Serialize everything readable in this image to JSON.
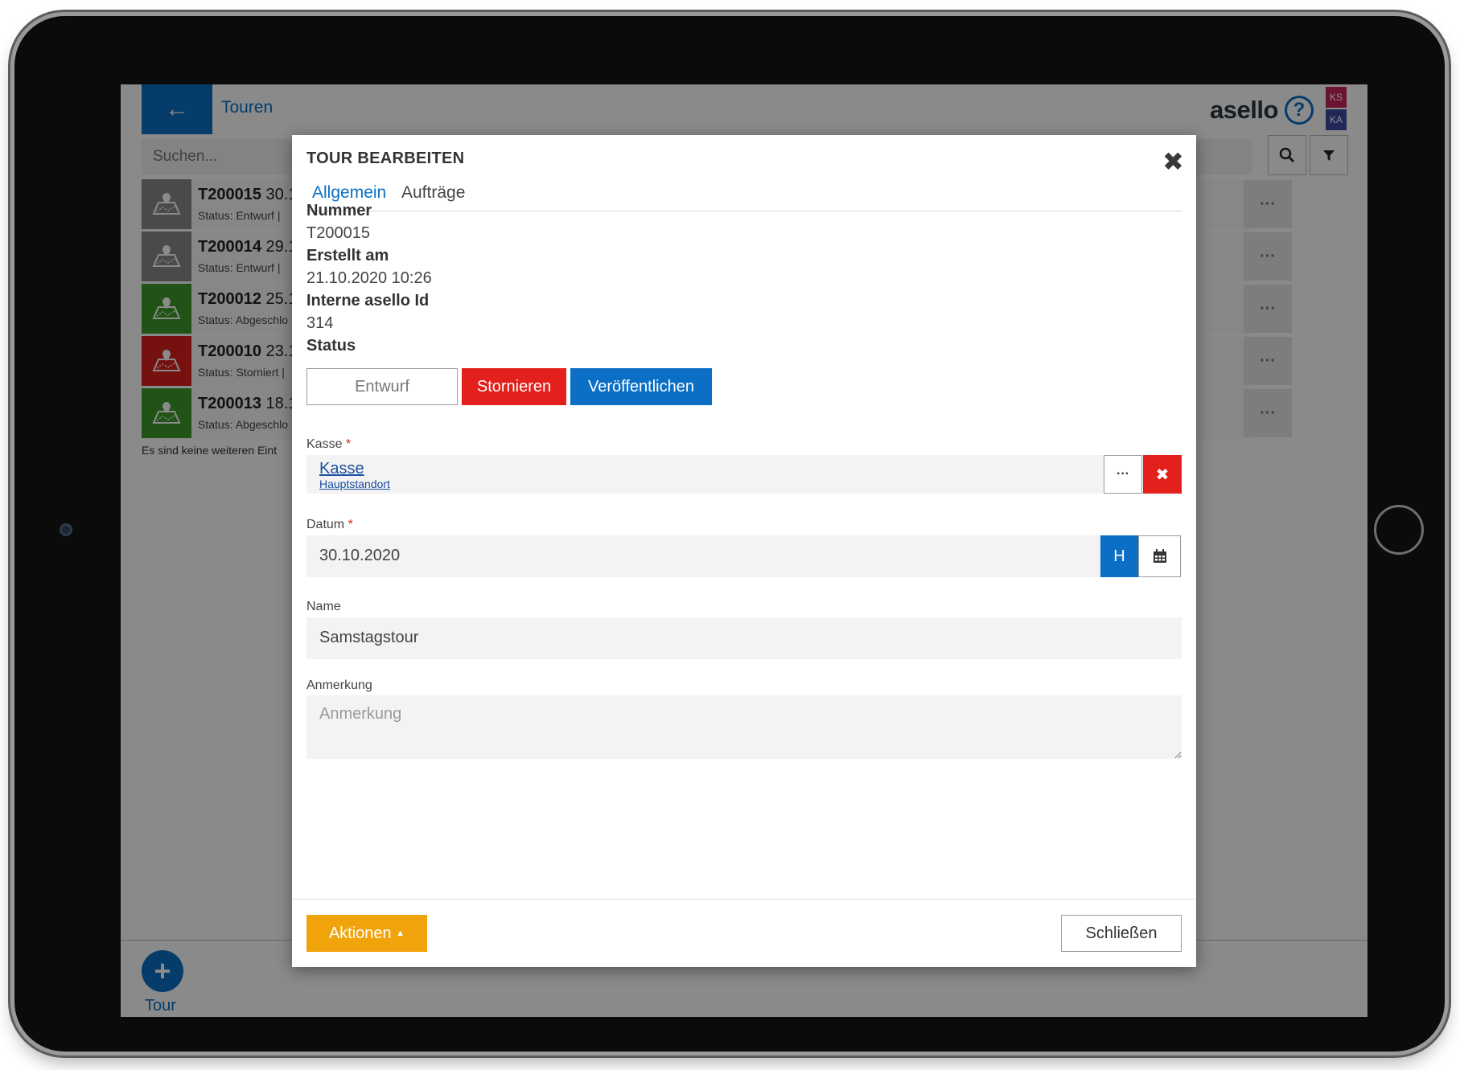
{
  "app": {
    "back_icon": "arrow-left-icon",
    "title": "Touren",
    "logo": "asello",
    "help_icon": "question-circle-icon",
    "user_badges": [
      "KS",
      "KA"
    ],
    "accent": "#0b6fc5"
  },
  "search": {
    "placeholder": "Suchen...",
    "value": "",
    "search_icon": "search-icon",
    "filter_icon": "filter-icon"
  },
  "tours": [
    {
      "number": "T200015",
      "date": "30.1",
      "status": "Status: Entwurf |",
      "status_color": "#8a8a8a"
    },
    {
      "number": "T200014",
      "date": "29.1",
      "status": "Status: Entwurf |",
      "status_color": "#8a8a8a"
    },
    {
      "number": "T200012",
      "date": "25.1",
      "status": "Status: Abgeschlo",
      "status_color": "#3d9a2b"
    },
    {
      "number": "T200010",
      "date": "23.1",
      "status": "Status: Storniert |",
      "status_color": "#d9201c"
    },
    {
      "number": "T200013",
      "date": "18.1",
      "status": "Status: Abgeschlo",
      "status_color": "#3d9a2b"
    }
  ],
  "list_footer": "Es sind keine weiteren Eint",
  "fab": {
    "icon": "plus-icon",
    "label": "Tour"
  },
  "modal": {
    "title": "TOUR BEARBEITEN",
    "close_icon": "close-icon",
    "tabs": [
      "Allgemein",
      "Aufträge"
    ],
    "fields": {
      "nummer": {
        "label": "Nummer",
        "value": "T200015"
      },
      "erstellt": {
        "label": "Erstellt am",
        "value": "21.10.2020 10:26"
      },
      "interne_id": {
        "label": "Interne asello Id",
        "value": "314"
      },
      "status": {
        "label": "Status"
      }
    },
    "status_buttons": {
      "draft": "Entwurf",
      "cancel": "Stornieren",
      "publish": "Veröffentlichen"
    },
    "kasse": {
      "label": "Kasse",
      "required": "*",
      "value": "Kasse",
      "sub": "Hauptstandort",
      "more": "···",
      "clear": "✖"
    },
    "datum": {
      "label": "Datum",
      "required": "*",
      "value": "30.10.2020",
      "today": "H",
      "calendar_icon": "calendar-icon"
    },
    "name": {
      "label": "Name",
      "value": "Samstagstour"
    },
    "anmerkung": {
      "label": "Anmerkung",
      "placeholder": "Anmerkung",
      "value": ""
    },
    "footer": {
      "actions": "Aktionen",
      "close": "Schließen"
    }
  }
}
